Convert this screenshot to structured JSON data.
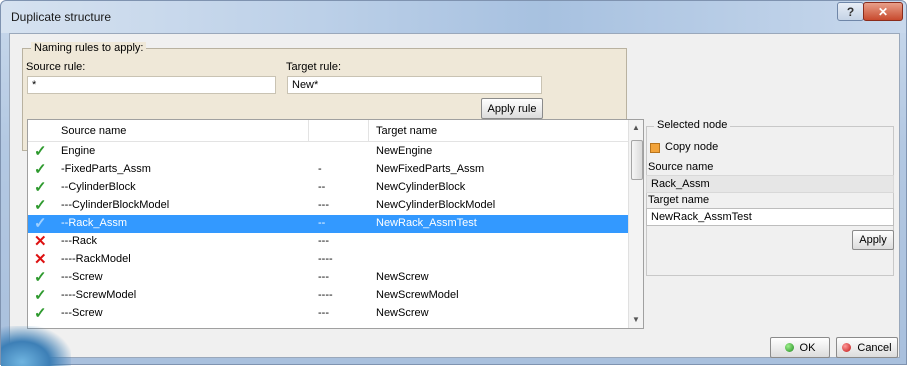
{
  "window": {
    "title": "Duplicate structure",
    "help_label": "?",
    "close_label": "✕"
  },
  "naming": {
    "legend": "Naming rules to apply:",
    "source_label": "Source rule:",
    "source_value": "*",
    "target_label": "Target rule:",
    "target_value": "New*",
    "apply_rule_label": "Apply rule"
  },
  "table": {
    "headers": [
      "Source name",
      "",
      "Target name"
    ],
    "rows": [
      {
        "status": "ok",
        "source": "Engine",
        "level": "",
        "target": "NewEngine",
        "selected": false
      },
      {
        "status": "ok",
        "source": "-FixedParts_Assm",
        "level": "-",
        "target": "NewFixedParts_Assm",
        "selected": false
      },
      {
        "status": "ok",
        "source": "--CylinderBlock",
        "level": "--",
        "target": "NewCylinderBlock",
        "selected": false
      },
      {
        "status": "ok",
        "source": "---CylinderBlockModel",
        "level": "---",
        "target": "NewCylinderBlockModel",
        "selected": false
      },
      {
        "status": "ok",
        "source": "--Rack_Assm",
        "level": "--",
        "target": "NewRack_AssmTest",
        "selected": true
      },
      {
        "status": "no",
        "source": "---Rack",
        "level": "---",
        "target": "",
        "selected": false
      },
      {
        "status": "no",
        "source": "----RackModel",
        "level": "----",
        "target": "",
        "selected": false
      },
      {
        "status": "ok",
        "source": "---Screw",
        "level": "---",
        "target": "NewScrew",
        "selected": false
      },
      {
        "status": "ok",
        "source": "----ScrewModel",
        "level": "----",
        "target": "NewScrewModel",
        "selected": false
      },
      {
        "status": "ok",
        "source": "---Screw",
        "level": "---",
        "target": "NewScrew",
        "selected": false
      }
    ],
    "check_glyph": "✓",
    "cross_glyph": "✕"
  },
  "selected_node": {
    "legend": "Selected node",
    "copy_node_label": "Copy node",
    "copy_node_checked": true,
    "source_name_label": "Source name",
    "source_name_value": "Rack_Assm",
    "target_name_label": "Target name",
    "target_name_value": "NewRack_AssmTest",
    "apply_label": "Apply"
  },
  "footer": {
    "ok_label": "OK",
    "cancel_label": "Cancel"
  },
  "colors": {
    "selection": "#3399ff",
    "ok_mark": "#2f9a2f",
    "no_mark": "#dd1111",
    "group_bg": "#efe8d8"
  }
}
